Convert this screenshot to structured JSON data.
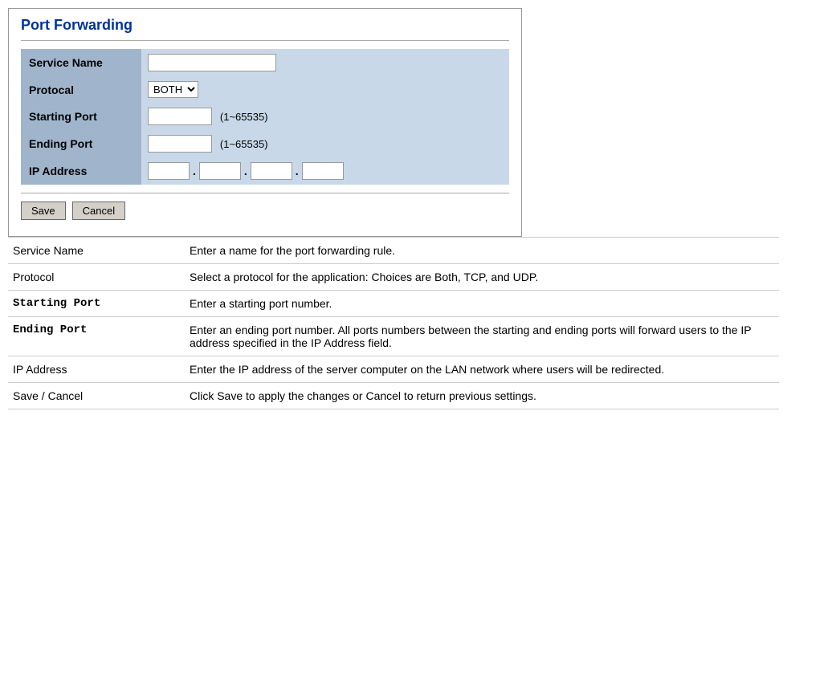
{
  "form": {
    "title": "Port Forwarding",
    "fields": {
      "service_name": {
        "label": "Service Name",
        "placeholder": ""
      },
      "protocol": {
        "label": "Protocal",
        "options": [
          "BOTH",
          "TCP",
          "UDP"
        ],
        "selected": "BOTH"
      },
      "starting_port": {
        "label": "Starting Port",
        "hint": "(1~65535)"
      },
      "ending_port": {
        "label": "Ending Port",
        "hint": "(1~65535)"
      },
      "ip_address": {
        "label": "IP Address"
      }
    },
    "buttons": {
      "save": "Save",
      "cancel": "Cancel"
    }
  },
  "descriptions": [
    {
      "term": "Service Name",
      "desc": "Enter a name for the port forwarding rule."
    },
    {
      "term": "Protocol",
      "desc": "Select a protocol for the application: Choices are Both, TCP, and UDP."
    },
    {
      "term": "Starting Port",
      "desc": "Enter a starting port number."
    },
    {
      "term": "Ending Port",
      "desc": "Enter an ending port number. All ports numbers between the starting and ending ports will forward users to the IP address specified in the IP Address field."
    },
    {
      "term": "IP Address",
      "desc": "Enter the IP address of the server computer on the LAN network where users will be redirected."
    },
    {
      "term": "Save / Cancel",
      "desc": "Click Save to apply the changes or Cancel to return previous settings."
    }
  ]
}
